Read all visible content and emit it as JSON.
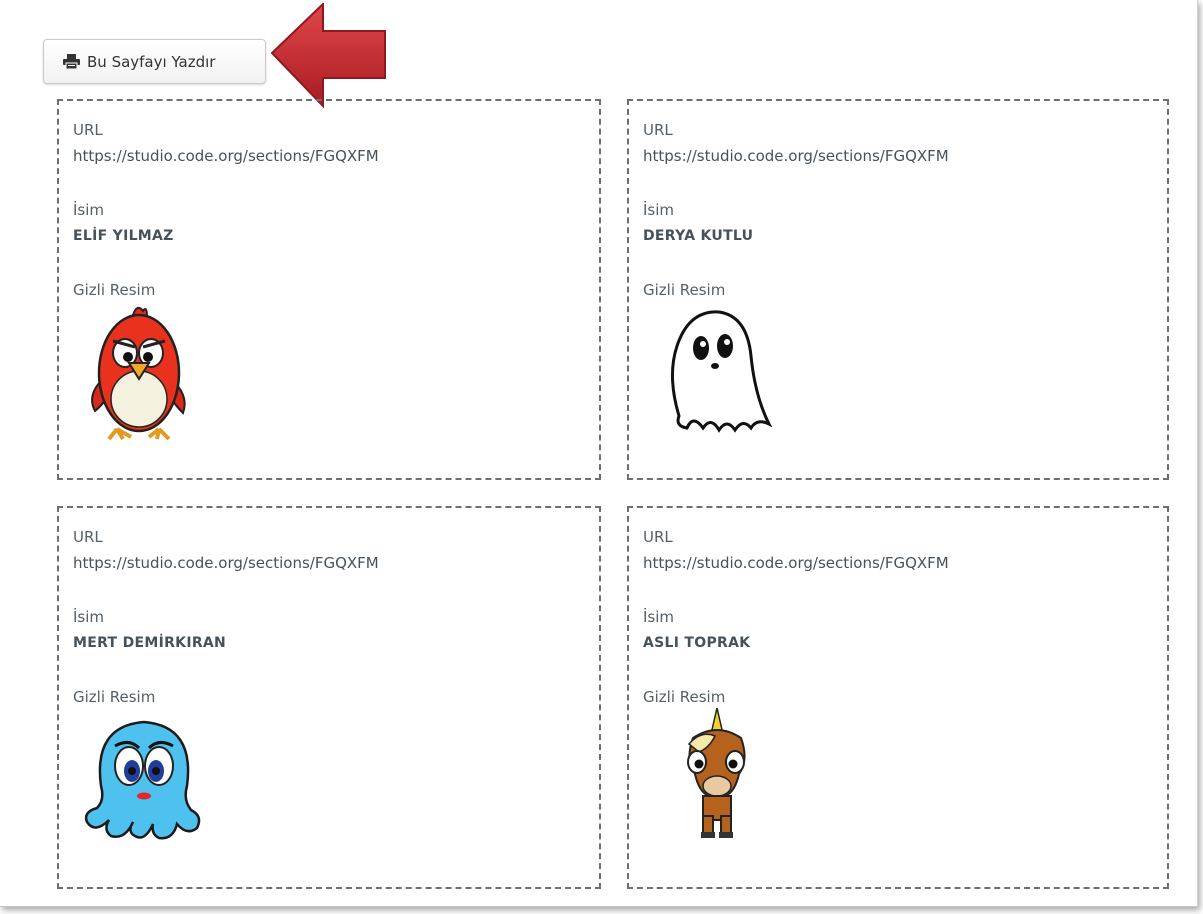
{
  "toolbar": {
    "print_label": "Bu Sayfayı Yazdır",
    "print_icon": "printer-icon"
  },
  "annotation": {
    "arrow_color": "#c0262d"
  },
  "cards": [
    {
      "url_label": "URL",
      "url": "https://studio.code.org/sections/FGQXFM",
      "name_label": "İsim",
      "name": "ELİF YILMAZ",
      "picture_label": "Gizli Resim",
      "picture": "red-bird"
    },
    {
      "url_label": "URL",
      "url": "https://studio.code.org/sections/FGQXFM",
      "name_label": "İsim",
      "name": "DERYA KUTLU",
      "picture_label": "Gizli Resim",
      "picture": "ghost"
    },
    {
      "url_label": "URL",
      "url": "https://studio.code.org/sections/FGQXFM",
      "name_label": "İsim",
      "name": "MERT DEMİRKIRAN",
      "picture_label": "Gizli Resim",
      "picture": "blue-octopus"
    },
    {
      "url_label": "URL",
      "url": "https://studio.code.org/sections/FGQXFM",
      "name_label": "İsim",
      "name": "ASLI TOPRAK",
      "picture_label": "Gizli Resim",
      "picture": "unicorn"
    }
  ]
}
